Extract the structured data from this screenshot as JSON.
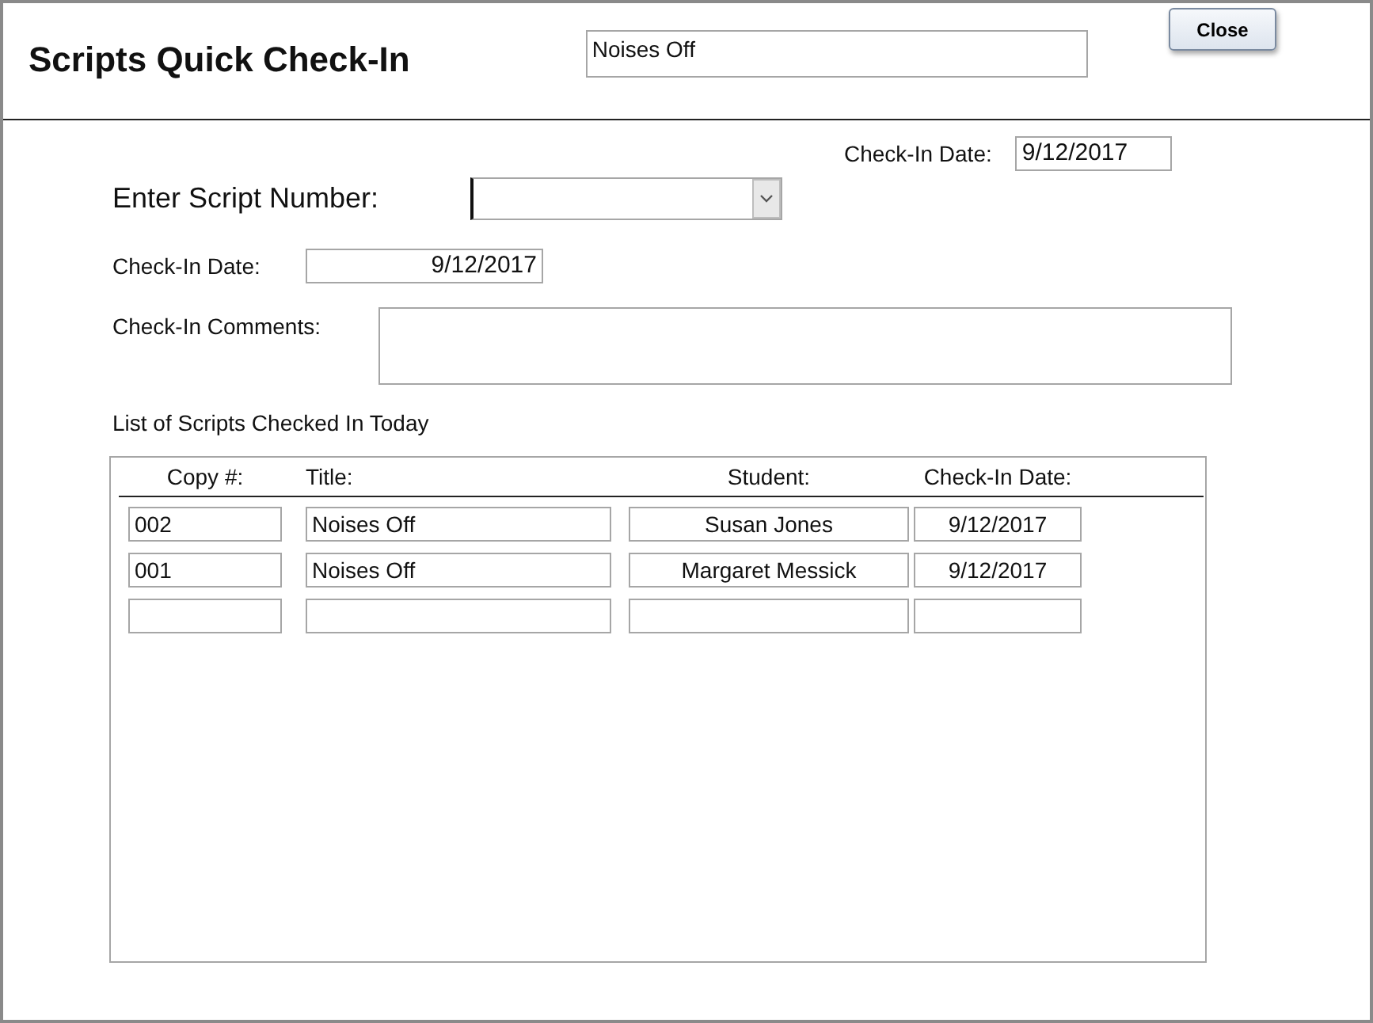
{
  "form": {
    "title": "Scripts Quick Check-In",
    "show_title": "Noises Off",
    "close_button": "Close"
  },
  "header_date": {
    "label": "Check-In Date:",
    "value": "9/12/2017"
  },
  "script_number": {
    "label": "Enter Script Number:"
  },
  "check_in_date": {
    "label": "Check-In Date:",
    "value": "9/12/2017"
  },
  "comments": {
    "label": "Check-In Comments:"
  },
  "list": {
    "title": "List of Scripts Checked In Today",
    "columns": [
      "Copy #:",
      "Title:",
      "Student:",
      "Check-In Date:"
    ],
    "rows": [
      {
        "copy": "002",
        "title": "Noises Off",
        "student": "Susan Jones",
        "date": "9/12/2017"
      },
      {
        "copy": "001",
        "title": "Noises Off",
        "student": "Margaret Messick",
        "date": "9/12/2017"
      }
    ],
    "new_record_row": true
  }
}
